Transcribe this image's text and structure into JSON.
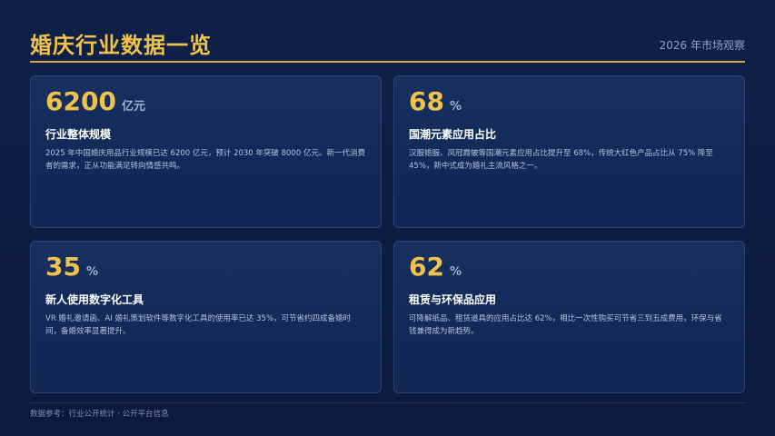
{
  "header": {
    "title": "婚庆行业数据一览",
    "subtitle": "2026 年市场观察"
  },
  "cards": [
    {
      "value": "6200",
      "unit": "亿元",
      "title": "行业整体规模",
      "desc": "2025 年中国婚庆用品行业规模已达 6200 亿元，预计 2030 年突破 8000 亿元。新一代消费者的需求，正从功能满足转向情感共鸣。"
    },
    {
      "value": "68",
      "unit": "%",
      "title": "国潮元素应用占比",
      "desc": "汉服婚服、凤冠霞帔等国潮元素应用占比提升至 68%，传统大红色产品占比从 75% 降至 45%，新中式成为婚礼主流风格之一。"
    },
    {
      "value": "35",
      "unit": "%",
      "title": "新人使用数字化工具",
      "desc": "VR 婚礼邀请函、AI 婚礼策划软件等数字化工具的使用率已达 35%，可节省约四成备婚时间，备婚效率显著提升。"
    },
    {
      "value": "62",
      "unit": "%",
      "title": "租赁与环保品应用",
      "desc": "可降解纸品、租赁道具的应用占比达 62%，相比一次性购买可节省三到五成费用，环保与省钱兼得成为新趋势。"
    }
  ],
  "footer": {
    "source": "数据参考：行业公开统计 · 公开平台信息"
  }
}
